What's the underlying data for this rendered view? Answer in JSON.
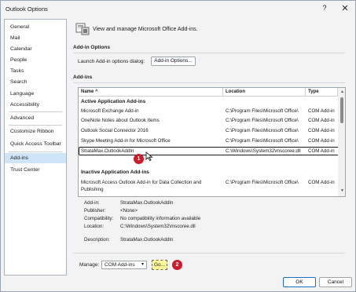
{
  "window": {
    "title": "Outlook Options",
    "help_glyph": "?",
    "close_glyph": "✕"
  },
  "sidebar": {
    "items": [
      {
        "label": "General"
      },
      {
        "label": "Mail"
      },
      {
        "label": "Calendar"
      },
      {
        "label": "People"
      },
      {
        "label": "Tasks"
      },
      {
        "label": "Search"
      },
      {
        "label": "Language"
      },
      {
        "label": "Accessibility"
      },
      {
        "label": "Advanced"
      },
      {
        "label": "Customize Ribbon"
      },
      {
        "label": "Quick Access Toolbar"
      },
      {
        "label": "Add-ins"
      },
      {
        "label": "Trust Center"
      }
    ],
    "selected": "Add-ins"
  },
  "header": {
    "text": "View and manage Microsoft Office Add-ins.",
    "icon": "addins-icon"
  },
  "addin_options": {
    "title": "Add-in Options",
    "launch_label": "Launch Add-in options dialog:",
    "button_label": "Add-in Options..."
  },
  "addins": {
    "title": "Add-ins",
    "columns": [
      "Name ^",
      "Location",
      "Type"
    ],
    "active_group": "Active Application Add-ins",
    "active_rows": [
      {
        "name": "Microsoft Exchange Add-in",
        "location": "C:\\Program Files\\Microsoft Office\\",
        "type": "COM Add-in"
      },
      {
        "name": "OneNote Notes about Outlook Items",
        "location": "C:\\Program Files\\Microsoft Office\\",
        "type": "COM Add-in"
      },
      {
        "name": "Outlook Social Connector 2016",
        "location": "C:\\Program Files\\Microsoft Office\\",
        "type": "COM Add-in"
      },
      {
        "name": "Skype Meeting Add-in for Microsoft Office",
        "location": "C:\\Program Files\\Microsoft Office\\",
        "type": "COM Add-in"
      },
      {
        "name": "StrataMax.OutlookAddIn",
        "location": "C:\\Windows\\System32\\mscoree.dll",
        "type": "COM Add-in"
      }
    ],
    "inactive_group": "Inactive Application Add-ins",
    "inactive_rows": [
      {
        "name1": "Microsoft Access Outlook Add-in for Data Collection and",
        "name2": "Publishing",
        "location": "C:\\Program Files\\Microsoft Office\\",
        "type": "COM Add-in"
      }
    ]
  },
  "details": {
    "addin_label": "Add-in:",
    "addin_value": "StrataMax.OutlookAddIn",
    "publisher_label": "Publisher:",
    "publisher_value": "<None>",
    "compat_label": "Compatibility:",
    "compat_value": "No compatibility information available",
    "location_label": "Location:",
    "location_value": "C:\\Windows\\System32\\mscoree.dll",
    "description_label": "Description:",
    "description_value": "StrataMax.OutlookAddIn"
  },
  "manage": {
    "label": "Manage:",
    "selected": "COM Add-ins",
    "go_label": "Go..."
  },
  "footer": {
    "ok_label": "OK",
    "cancel_label": "Cancel"
  },
  "badges": {
    "step1": "1",
    "step2": "2"
  },
  "colors": {
    "selection": "#cfe4f7",
    "badge": "#d0192a",
    "go_highlight": "#fff89a"
  }
}
